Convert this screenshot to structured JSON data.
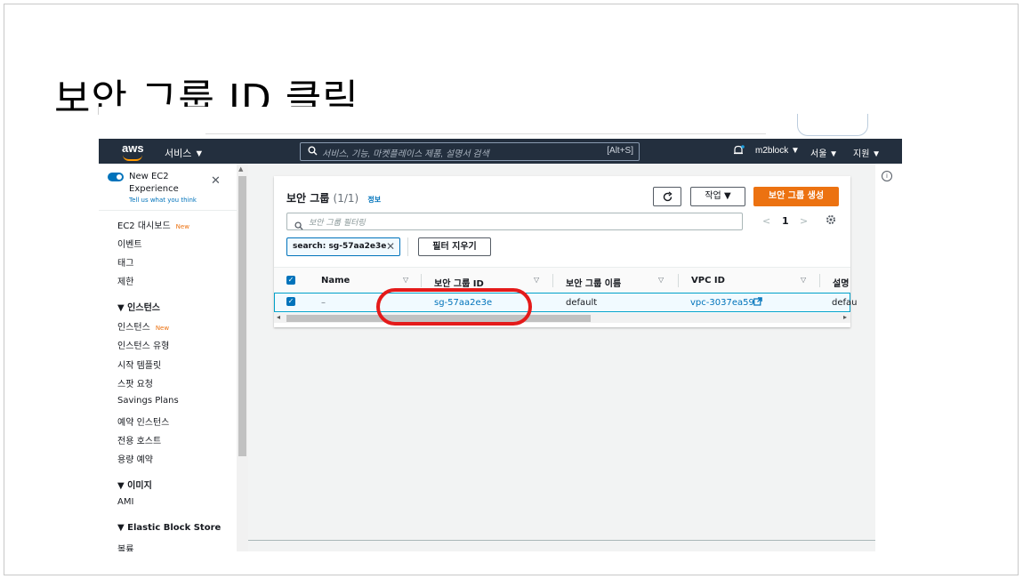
{
  "slide": {
    "title": "보안 그룹 ID 클릭"
  },
  "topnav": {
    "logo": "aws",
    "services": "서비스 ▼",
    "search_placeholder": "서비스, 기능, 마켓플레이스 제품, 설명서 검색",
    "search_shortcut": "[Alt+S]",
    "account": "m2block ▼",
    "region": "서울 ▼",
    "support": "지원 ▼"
  },
  "sidebar": {
    "new_ec2": "New EC2",
    "experience": "Experience",
    "tell_us": "Tell us what you think",
    "close": "✕",
    "new_badge": "New",
    "items": [
      {
        "label": "EC2 대시보드",
        "new": true
      },
      {
        "label": "이벤트"
      },
      {
        "label": "태그"
      },
      {
        "label": "제한"
      },
      {
        "label": "▼  인스턴스",
        "head": true
      },
      {
        "label": "인스턴스",
        "new": true
      },
      {
        "label": "인스턴스 유형"
      },
      {
        "label": "시작 템플릿"
      },
      {
        "label": "스팟 요청"
      },
      {
        "label": "Savings Plans"
      },
      {
        "label": "예약 인스턴스"
      },
      {
        "label": "전용 호스트"
      },
      {
        "label": "용량 예약"
      },
      {
        "label": "▼  이미지",
        "head": true
      },
      {
        "label": "AMI"
      },
      {
        "label": "▼  Elastic Block Store",
        "head": true
      },
      {
        "label": "볼륨"
      }
    ]
  },
  "panel": {
    "title": "보안 그룹",
    "count": "(1/1)",
    "info": "정보",
    "refresh": "C",
    "actions": "작업 ▼",
    "create": "보안 그룹 생성",
    "filter_placeholder": "보안 그룹 필터링",
    "page_prev": "<",
    "page_num": "1",
    "page_next": ">",
    "token": "search: sg-57aa2e3e",
    "token_remove": "✕",
    "clear_filters": "필터 지우기",
    "columns": [
      "Name",
      "보안 그룹 ID",
      "보안 그룹 이름",
      "VPC ID",
      "설명"
    ],
    "row": {
      "name": "–",
      "sg_id": "sg-57aa2e3e",
      "sg_name": "default",
      "vpc_id": "vpc-3037ea59",
      "desc": "defau"
    }
  },
  "colors": {
    "nav_bg": "#232f3e",
    "primary": "#ec7211",
    "link": "#0073bb",
    "highlight": "#e41a1a"
  }
}
